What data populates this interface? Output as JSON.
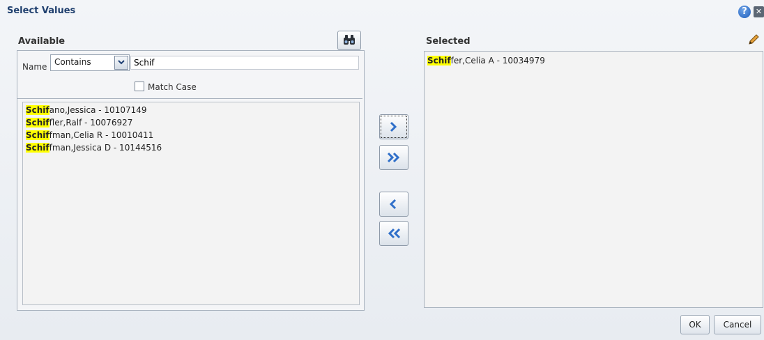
{
  "dialog": {
    "title": "Select Values"
  },
  "available": {
    "label": "Available",
    "filter": {
      "name_label": "Name",
      "operator": "Contains",
      "value": "Schif",
      "match_case_label": "Match Case",
      "match_case_checked": false
    },
    "items": [
      {
        "match": "Schif",
        "rest": "ano,Jessica - 10107149"
      },
      {
        "match": "Schif",
        "rest": "fler,Ralf - 10076927"
      },
      {
        "match": "Schif",
        "rest": "fman,Celia R - 10010411"
      },
      {
        "match": "Schif",
        "rest": "fman,Jessica D - 10144516"
      }
    ]
  },
  "selected": {
    "label": "Selected",
    "items": [
      {
        "match": "Schif",
        "rest": "fer,Celia A - 10034979"
      }
    ]
  },
  "buttons": {
    "ok": "OK",
    "cancel": "Cancel"
  },
  "icons": {
    "help": "help-icon",
    "close": "close-icon",
    "search": "binoculars-icon",
    "edit": "pencil-icon",
    "move": "chevron-right-icon",
    "move_all": "double-chevron-right-icon",
    "remove": "chevron-left-icon",
    "remove_all": "double-chevron-left-icon"
  },
  "colors": {
    "title": "#1f3f6e",
    "highlight": "#ffff00",
    "accent": "#1d5dbb"
  }
}
